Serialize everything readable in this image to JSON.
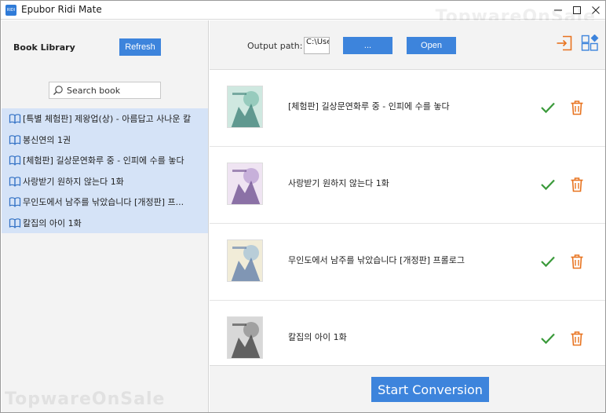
{
  "window": {
    "title": "Epubor Ridi Mate",
    "app_icon_text": "RIDI",
    "watermark": "TopwareOnSale"
  },
  "library": {
    "title": "Book Library",
    "refresh_label": "Refresh",
    "search_placeholder": "Search book",
    "items": [
      {
        "label": "[특별 체험판] 제왕업(상) - 아름답고 사나운 칼"
      },
      {
        "label": "봉신연의 1권"
      },
      {
        "label": "[체험판] 길상문연화루 중 - 인피에 수를 놓다"
      },
      {
        "label": "사랑받기 원하지 않는다 1화"
      },
      {
        "label": "무인도에서 남주를 낚았습니다 [개정판] 프..."
      },
      {
        "label": "칼집의 아이 1화"
      }
    ]
  },
  "toolbar": {
    "output_label": "Output path:",
    "output_value": "C:\\Users",
    "browse_label": "...",
    "open_label": "Open"
  },
  "conversions": [
    {
      "title": "[체험판] 길상문연화루 중 - 인피에 수를 놓다",
      "status": "done",
      "cover_colors": [
        "#cfe8e0",
        "#7fbfae",
        "#3b7f75"
      ]
    },
    {
      "title": "사랑받기 원하지 않는다 1화",
      "status": "done",
      "cover_colors": [
        "#efe4f2",
        "#b69ad0",
        "#6a4b8c"
      ]
    },
    {
      "title": "무인도에서 남주를 낚았습니다 [개정판] 프롤로그",
      "status": "done",
      "cover_colors": [
        "#f1ecd8",
        "#9fc0d8",
        "#5a7aa8"
      ]
    },
    {
      "title": "칼집의 아이 1화",
      "status": "done",
      "cover_colors": [
        "#d8d8d8",
        "#8a8a8a",
        "#3a3a3a"
      ]
    }
  ],
  "actions": {
    "start_label": "Start Conversion"
  },
  "colors": {
    "accent": "#3d84dc",
    "check": "#3a9a3a",
    "trash": "#e8731f",
    "list_highlight": "#d5e3f7"
  }
}
